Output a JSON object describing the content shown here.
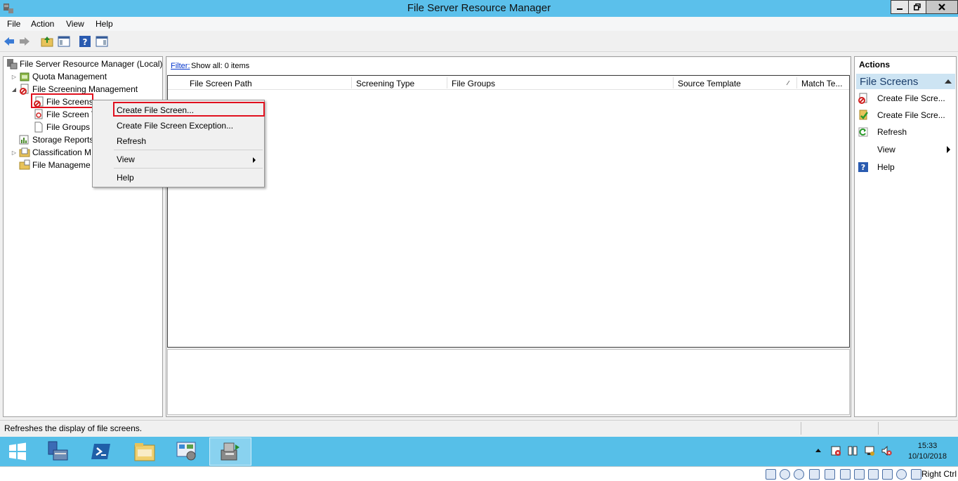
{
  "window": {
    "title": "File Server Resource Manager"
  },
  "menubar": {
    "items": [
      "File",
      "Action",
      "View",
      "Help"
    ]
  },
  "tree": {
    "root": "File Server Resource Manager (Local)",
    "items": [
      {
        "label": "Quota Management"
      },
      {
        "label": "File Screening Management"
      },
      {
        "label": "File Screens"
      },
      {
        "label": "File Screen T"
      },
      {
        "label": "File Groups"
      },
      {
        "label": "Storage Reports"
      },
      {
        "label": "Classification M"
      },
      {
        "label": "File Manageme"
      }
    ]
  },
  "filter": {
    "label": "Filter:",
    "value": "Show all: 0 items"
  },
  "columns": [
    "File Screen Path",
    "Screening Type",
    "File Groups",
    "Source Template",
    "Match Te..."
  ],
  "context_menu": {
    "items": [
      "Create File Screen...",
      "Create File Screen Exception...",
      "Refresh",
      "View",
      "Help"
    ]
  },
  "actions": {
    "title": "Actions",
    "section": "File Screens",
    "items": [
      "Create File Scre...",
      "Create File Scre...",
      "Refresh",
      "View",
      "Help"
    ]
  },
  "status": {
    "text": "Refreshes the display of file screens."
  },
  "clock": {
    "time": "15:33",
    "date": "10/10/2018"
  },
  "vmbar": {
    "key_label": "Right Ctrl"
  },
  "colors": {
    "titlebar": "#5bc0eb",
    "taskbar": "#56bfe8",
    "highlight_border": "#e0101e",
    "action_header": "#cde4f3"
  }
}
